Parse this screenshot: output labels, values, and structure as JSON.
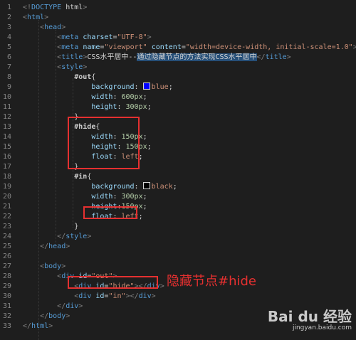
{
  "editor": {
    "lines": [
      {
        "n": "1",
        "parts": [
          [
            "punc",
            "<!"
          ],
          [
            "tag",
            "DOCTYPE"
          ],
          [
            "txt",
            " html"
          ],
          [
            "punc",
            ">"
          ]
        ]
      },
      {
        "n": "2",
        "parts": [
          [
            "punc",
            "<"
          ],
          [
            "tag",
            "html"
          ],
          [
            "punc",
            ">"
          ]
        ]
      },
      {
        "n": "3",
        "parts": [
          [
            "txt",
            "    "
          ],
          [
            "punc",
            "<"
          ],
          [
            "tag",
            "head"
          ],
          [
            "punc",
            ">"
          ]
        ]
      },
      {
        "n": "4",
        "parts": [
          [
            "txt",
            "        "
          ],
          [
            "punc",
            "<"
          ],
          [
            "tag",
            "meta"
          ],
          [
            "txt",
            " "
          ],
          [
            "attr",
            "charset"
          ],
          [
            "txt",
            "="
          ],
          [
            "str",
            "\"UTF-8\""
          ],
          [
            "punc",
            ">"
          ]
        ]
      },
      {
        "n": "5",
        "parts": [
          [
            "txt",
            "        "
          ],
          [
            "punc",
            "<"
          ],
          [
            "tag",
            "meta"
          ],
          [
            "txt",
            " "
          ],
          [
            "attr",
            "name"
          ],
          [
            "txt",
            "="
          ],
          [
            "str",
            "\"viewport\""
          ],
          [
            "txt",
            " "
          ],
          [
            "attr",
            "content"
          ],
          [
            "txt",
            "="
          ],
          [
            "str",
            "\"width=device-width, initial-scale=1.0\""
          ],
          [
            "punc",
            ">"
          ]
        ]
      },
      {
        "n": "6",
        "parts": [
          [
            "txt",
            "        "
          ],
          [
            "punc",
            "<"
          ],
          [
            "tag",
            "title"
          ],
          [
            "punc",
            ">"
          ],
          [
            "txt",
            "CSS水平居中--"
          ],
          [
            "hl",
            "通过隐藏节点的方法实现CSS水平居中"
          ],
          [
            "punc",
            "</"
          ],
          [
            "tag",
            "title"
          ],
          [
            "punc",
            ">"
          ]
        ]
      },
      {
        "n": "7",
        "parts": [
          [
            "txt",
            "        "
          ],
          [
            "punc",
            "<"
          ],
          [
            "tag",
            "style"
          ],
          [
            "punc",
            ">"
          ]
        ]
      },
      {
        "n": "8",
        "parts": [
          [
            "txt",
            "            "
          ],
          [
            "sel",
            "#out"
          ],
          [
            "txt",
            "{"
          ]
        ]
      },
      {
        "n": "9",
        "parts": [
          [
            "txt",
            "                "
          ],
          [
            "prop",
            "background"
          ],
          [
            "txt",
            ": "
          ],
          [
            "swatch",
            "#0000ff"
          ],
          [
            "val",
            "blue"
          ],
          [
            "txt",
            ";"
          ]
        ]
      },
      {
        "n": "10",
        "parts": [
          [
            "txt",
            "                "
          ],
          [
            "prop",
            "width"
          ],
          [
            "txt",
            ": "
          ],
          [
            "num",
            "600px"
          ],
          [
            "txt",
            ";"
          ]
        ]
      },
      {
        "n": "11",
        "parts": [
          [
            "txt",
            "                "
          ],
          [
            "prop",
            "height"
          ],
          [
            "txt",
            ": "
          ],
          [
            "num",
            "300px"
          ],
          [
            "txt",
            ";"
          ]
        ]
      },
      {
        "n": "12",
        "parts": [
          [
            "txt",
            "            }"
          ]
        ]
      },
      {
        "n": "13",
        "parts": [
          [
            "txt",
            "            "
          ],
          [
            "sel",
            "#hide"
          ],
          [
            "txt",
            "{"
          ]
        ]
      },
      {
        "n": "14",
        "parts": [
          [
            "txt",
            "                "
          ],
          [
            "prop",
            "width"
          ],
          [
            "txt",
            ": "
          ],
          [
            "num",
            "150px"
          ],
          [
            "txt",
            ";"
          ]
        ]
      },
      {
        "n": "15",
        "parts": [
          [
            "txt",
            "                "
          ],
          [
            "prop",
            "height"
          ],
          [
            "txt",
            ": "
          ],
          [
            "num",
            "150px"
          ],
          [
            "txt",
            ";"
          ]
        ]
      },
      {
        "n": "16",
        "parts": [
          [
            "txt",
            "                "
          ],
          [
            "prop",
            "float"
          ],
          [
            "txt",
            ": "
          ],
          [
            "val",
            "left"
          ],
          [
            "txt",
            ";"
          ]
        ]
      },
      {
        "n": "17",
        "parts": [
          [
            "txt",
            "            }"
          ]
        ]
      },
      {
        "n": "18",
        "parts": [
          [
            "txt",
            "            "
          ],
          [
            "sel",
            "#in"
          ],
          [
            "txt",
            "{"
          ]
        ]
      },
      {
        "n": "19",
        "parts": [
          [
            "txt",
            "                "
          ],
          [
            "prop",
            "background"
          ],
          [
            "txt",
            ": "
          ],
          [
            "swatch",
            "#000000"
          ],
          [
            "val",
            "black"
          ],
          [
            "txt",
            ";"
          ]
        ]
      },
      {
        "n": "20",
        "parts": [
          [
            "txt",
            "                "
          ],
          [
            "prop",
            "width"
          ],
          [
            "txt",
            ": "
          ],
          [
            "num",
            "300px"
          ],
          [
            "txt",
            ";"
          ]
        ]
      },
      {
        "n": "21",
        "parts": [
          [
            "txt",
            "                "
          ],
          [
            "prop",
            "height"
          ],
          [
            "txt",
            ":"
          ],
          [
            "num",
            "150px"
          ],
          [
            "txt",
            ";"
          ]
        ]
      },
      {
        "n": "22",
        "parts": [
          [
            "txt",
            "                "
          ],
          [
            "prop",
            "float"
          ],
          [
            "txt",
            ": "
          ],
          [
            "val",
            "left"
          ],
          [
            "txt",
            ";"
          ]
        ]
      },
      {
        "n": "23",
        "parts": [
          [
            "txt",
            "            }"
          ]
        ]
      },
      {
        "n": "24",
        "parts": [
          [
            "txt",
            "        "
          ],
          [
            "punc",
            "</"
          ],
          [
            "tag",
            "style"
          ],
          [
            "punc",
            ">"
          ]
        ]
      },
      {
        "n": "25",
        "parts": [
          [
            "txt",
            "    "
          ],
          [
            "punc",
            "</"
          ],
          [
            "tag",
            "head"
          ],
          [
            "punc",
            ">"
          ]
        ]
      },
      {
        "n": "26",
        "parts": [
          [
            "txt",
            ""
          ]
        ]
      },
      {
        "n": "27",
        "parts": [
          [
            "txt",
            "    "
          ],
          [
            "punc",
            "<"
          ],
          [
            "tag",
            "body"
          ],
          [
            "punc",
            ">"
          ]
        ]
      },
      {
        "n": "28",
        "parts": [
          [
            "txt",
            "        "
          ],
          [
            "punc",
            "<"
          ],
          [
            "tag",
            "div"
          ],
          [
            "txt",
            " "
          ],
          [
            "attr",
            "id"
          ],
          [
            "txt",
            "="
          ],
          [
            "str",
            "\"out\""
          ],
          [
            "punc",
            ">"
          ]
        ]
      },
      {
        "n": "29",
        "parts": [
          [
            "txt",
            "            "
          ],
          [
            "punc",
            "<"
          ],
          [
            "tag",
            "div"
          ],
          [
            "txt",
            " "
          ],
          [
            "attr",
            "id"
          ],
          [
            "txt",
            "="
          ],
          [
            "str",
            "\"hide\""
          ],
          [
            "punc",
            "></"
          ],
          [
            "tag",
            "div"
          ],
          [
            "punc",
            ">"
          ]
        ]
      },
      {
        "n": "30",
        "parts": [
          [
            "txt",
            "            "
          ],
          [
            "punc",
            "<"
          ],
          [
            "tag",
            "div"
          ],
          [
            "txt",
            " "
          ],
          [
            "attr",
            "id"
          ],
          [
            "txt",
            "="
          ],
          [
            "str",
            "\"in\""
          ],
          [
            "punc",
            "></"
          ],
          [
            "tag",
            "div"
          ],
          [
            "punc",
            ">"
          ]
        ]
      },
      {
        "n": "31",
        "parts": [
          [
            "txt",
            "        "
          ],
          [
            "punc",
            "</"
          ],
          [
            "tag",
            "div"
          ],
          [
            "punc",
            ">"
          ]
        ]
      },
      {
        "n": "32",
        "parts": [
          [
            "txt",
            "    "
          ],
          [
            "punc",
            "</"
          ],
          [
            "tag",
            "body"
          ],
          [
            "punc",
            ">"
          ]
        ]
      },
      {
        "n": "33",
        "parts": [
          [
            "punc",
            "</"
          ],
          [
            "tag",
            "html"
          ],
          [
            "punc",
            ">"
          ]
        ]
      }
    ]
  },
  "annotation": {
    "text": "隐藏节点#hide",
    "color": "#e53030"
  },
  "watermark": {
    "logo": "Bai du 经验",
    "url": "jingyan.baidu.com"
  },
  "colors": {
    "background": "#1e1e1e",
    "highlight_box": "#e53030",
    "selection": "#264f78"
  }
}
